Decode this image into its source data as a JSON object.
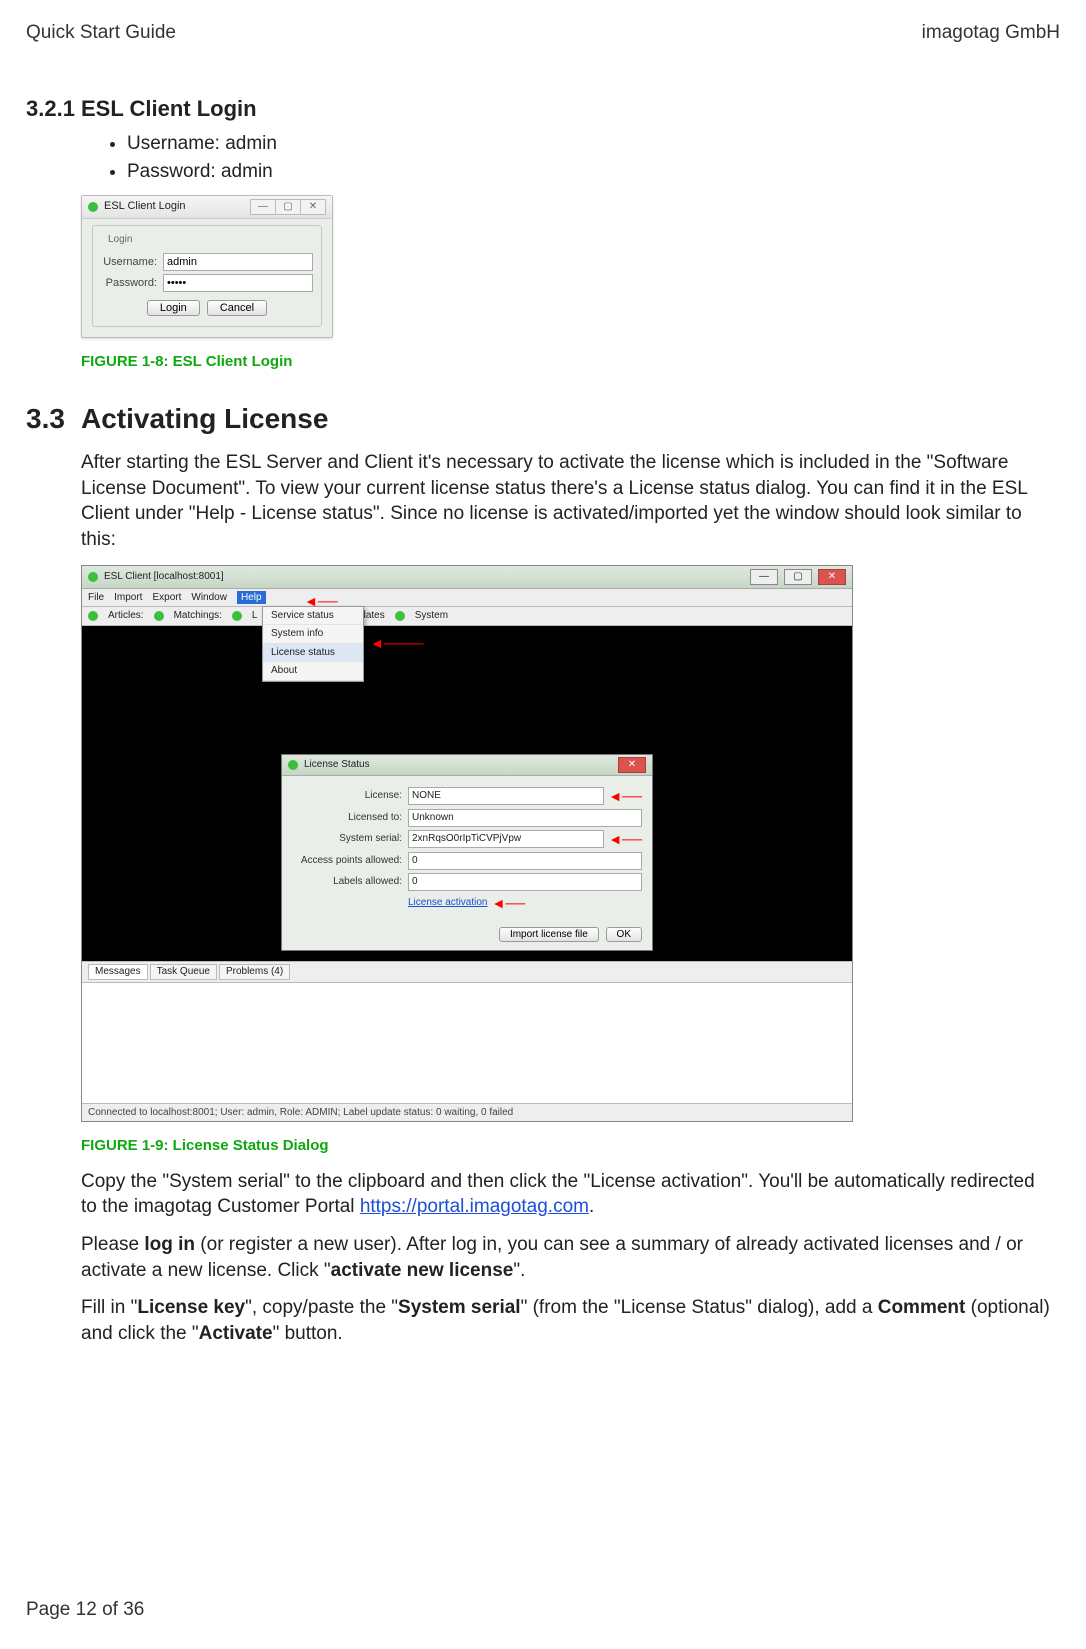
{
  "header": {
    "left": "Quick Start Guide",
    "right": "imagotag GmbH"
  },
  "section321": {
    "number": "3.2.1",
    "title": "ESL Client Login",
    "bullets": [
      "Username: admin",
      "Password: admin"
    ],
    "figure_caption": "FIGURE 1-8: ESL Client Login"
  },
  "login_dialog": {
    "window_title": "ESL Client Login",
    "group_label": "Login",
    "username_label": "Username:",
    "username_value": "admin",
    "password_label": "Password:",
    "password_value": "•••••",
    "login_btn": "Login",
    "cancel_btn": "Cancel"
  },
  "section33": {
    "number": "3.3",
    "title": "Activating License",
    "intro": "After starting the ESL Server and Client it's necessary to activate the license which is included in the \"Software License Document\". To view your current license status there's a License status dialog. You can find it in the ESL Client under \"Help - License status\". Since no license is activated/imported yet the window should look similar to this:",
    "figure_caption": "FIGURE 1-9: License Status Dialog",
    "p_copy_a": "Copy the \"System serial\" to the clipboard and then click the \"License activation\". You'll be automatically redirected to the imagotag Customer Portal ",
    "portal_url": "https://portal.imagotag.com",
    "p_copy_b": ".",
    "p_login_a": "Please ",
    "p_login_bold": "log in",
    "p_login_b": " (or register a new user). After log in, you can see a summary of already activated licenses and / or activate a new license. Click \"",
    "p_login_bold2": "activate new license",
    "p_login_c": "\".",
    "p_fill_a": "Fill in \"",
    "p_fill_b1": "License key",
    "p_fill_b": "\", copy/paste the \"",
    "p_fill_b2": "System serial",
    "p_fill_c": "\" (from the \"License Status\" dialog), add a ",
    "p_fill_b3": "Comment",
    "p_fill_d": " (optional) and click the \"",
    "p_fill_b4": "Activate",
    "p_fill_e": "\" button."
  },
  "app_window": {
    "title": "ESL Client [localhost:8001]",
    "menus": {
      "file": "File",
      "import": "Import",
      "export": "Export",
      "window": "Window",
      "help": "Help"
    },
    "help_menu": {
      "i1": "Service status",
      "i2": "System info",
      "i3": "License status",
      "i4": "About"
    },
    "status_row": {
      "articles": "Articles:",
      "matchings": "Matchings:",
      "l": "L",
      "updates": "Updates",
      "system": "System"
    },
    "license": {
      "title": "License Status",
      "rows": {
        "license_lbl": "License:",
        "license_val": "NONE",
        "licensed_to_lbl": "Licensed to:",
        "licensed_to_val": "Unknown",
        "serial_lbl": "System serial:",
        "serial_val": "2xnRqsO0rIpTiCVPjVpw",
        "ap_lbl": "Access points allowed:",
        "ap_val": "0",
        "labels_lbl": "Labels allowed:",
        "labels_val": "0",
        "activation_link": "License activation"
      },
      "import_btn": "Import license file",
      "ok_btn": "OK"
    },
    "tabs": {
      "messages": "Messages",
      "task_queue": "Task Queue",
      "problems": "Problems (4)"
    },
    "footer": "Connected to localhost:8001; User: admin, Role: ADMIN; Label update status: 0 waiting, 0 failed"
  },
  "page_footer": "Page 12 of 36"
}
